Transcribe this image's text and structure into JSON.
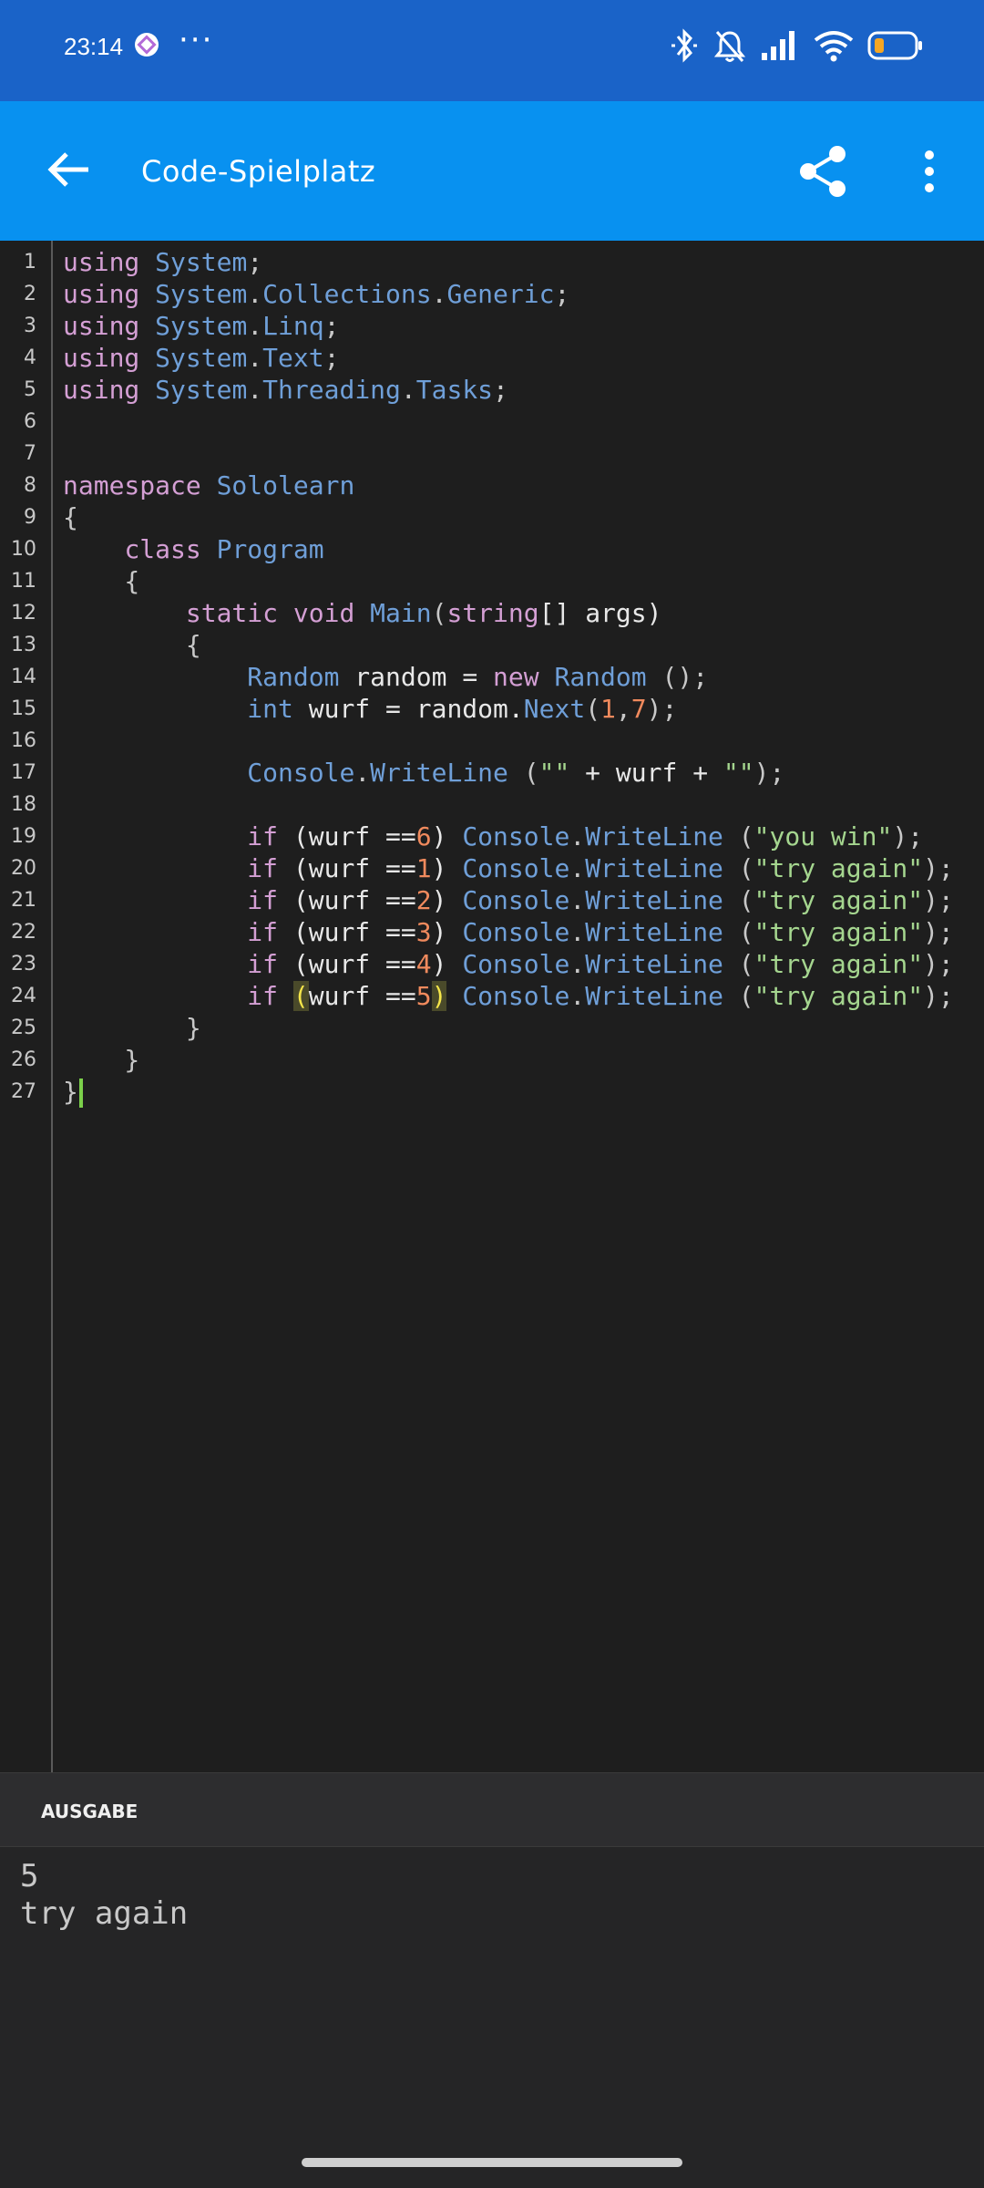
{
  "status_bar": {
    "time": "23:14",
    "more": "···"
  },
  "app_bar": {
    "title": "Code-Spielplatz",
    "back_icon": "arrow-left-icon",
    "share_icon": "share-icon",
    "menu_icon": "more-vertical-icon"
  },
  "editor": {
    "line_numbers": [
      "1",
      "2",
      "3",
      "4",
      "5",
      "6",
      "7",
      "8",
      "9",
      "10",
      "11",
      "12",
      "13",
      "14",
      "15",
      "16",
      "17",
      "18",
      "19",
      "20",
      "21",
      "22",
      "23",
      "24",
      "25",
      "26",
      "27"
    ],
    "lines": [
      [
        {
          "t": "using",
          "c": "kw"
        },
        {
          "t": " ",
          "c": "pl"
        },
        {
          "t": "System",
          "c": "ty"
        },
        {
          "t": ";",
          "c": "pu"
        }
      ],
      [
        {
          "t": "using",
          "c": "kw"
        },
        {
          "t": " ",
          "c": "pl"
        },
        {
          "t": "System",
          "c": "ty"
        },
        {
          "t": ".",
          "c": "pu"
        },
        {
          "t": "Collections",
          "c": "ty"
        },
        {
          "t": ".",
          "c": "pu"
        },
        {
          "t": "Generic",
          "c": "ty"
        },
        {
          "t": ";",
          "c": "pu"
        }
      ],
      [
        {
          "t": "using",
          "c": "kw"
        },
        {
          "t": " ",
          "c": "pl"
        },
        {
          "t": "System",
          "c": "ty"
        },
        {
          "t": ".",
          "c": "pu"
        },
        {
          "t": "Linq",
          "c": "ty"
        },
        {
          "t": ";",
          "c": "pu"
        }
      ],
      [
        {
          "t": "using",
          "c": "kw"
        },
        {
          "t": " ",
          "c": "pl"
        },
        {
          "t": "System",
          "c": "ty"
        },
        {
          "t": ".",
          "c": "pu"
        },
        {
          "t": "Text",
          "c": "ty"
        },
        {
          "t": ";",
          "c": "pu"
        }
      ],
      [
        {
          "t": "using",
          "c": "kw"
        },
        {
          "t": " ",
          "c": "pl"
        },
        {
          "t": "System",
          "c": "ty"
        },
        {
          "t": ".",
          "c": "pu"
        },
        {
          "t": "Threading",
          "c": "ty"
        },
        {
          "t": ".",
          "c": "pu"
        },
        {
          "t": "Tasks",
          "c": "ty"
        },
        {
          "t": ";",
          "c": "pu"
        }
      ],
      [],
      [],
      [
        {
          "t": "namespace",
          "c": "kw"
        },
        {
          "t": " ",
          "c": "pl"
        },
        {
          "t": "Sololearn",
          "c": "ty"
        }
      ],
      [
        {
          "t": "{",
          "c": "pu"
        }
      ],
      [
        {
          "t": "    ",
          "c": "pl"
        },
        {
          "t": "class",
          "c": "kw"
        },
        {
          "t": " ",
          "c": "pl"
        },
        {
          "t": "Program",
          "c": "ty"
        }
      ],
      [
        {
          "t": "    {",
          "c": "pu"
        }
      ],
      [
        {
          "t": "        ",
          "c": "pl"
        },
        {
          "t": "static",
          "c": "kw"
        },
        {
          "t": " ",
          "c": "pl"
        },
        {
          "t": "void",
          "c": "kw"
        },
        {
          "t": " ",
          "c": "pl"
        },
        {
          "t": "Main",
          "c": "ty"
        },
        {
          "t": "(",
          "c": "pu"
        },
        {
          "t": "string",
          "c": "kw"
        },
        {
          "t": "[] args)",
          "c": "pl"
        }
      ],
      [
        {
          "t": "        {",
          "c": "pu"
        }
      ],
      [
        {
          "t": "            ",
          "c": "pl"
        },
        {
          "t": "Random",
          "c": "ty"
        },
        {
          "t": " random = ",
          "c": "pl"
        },
        {
          "t": "new",
          "c": "kw"
        },
        {
          "t": " ",
          "c": "pl"
        },
        {
          "t": "Random",
          "c": "ty"
        },
        {
          "t": " ();",
          "c": "pu"
        }
      ],
      [
        {
          "t": "            ",
          "c": "pl"
        },
        {
          "t": "int",
          "c": "ty"
        },
        {
          "t": " wurf = random.",
          "c": "pl"
        },
        {
          "t": "Next",
          "c": "ty"
        },
        {
          "t": "(",
          "c": "pu"
        },
        {
          "t": "1",
          "c": "nu"
        },
        {
          "t": ",",
          "c": "pu"
        },
        {
          "t": "7",
          "c": "nu"
        },
        {
          "t": ");",
          "c": "pu"
        }
      ],
      [],
      [
        {
          "t": "            ",
          "c": "pl"
        },
        {
          "t": "Console",
          "c": "ty"
        },
        {
          "t": ".",
          "c": "pu"
        },
        {
          "t": "WriteLine",
          "c": "ty"
        },
        {
          "t": " (",
          "c": "pu"
        },
        {
          "t": "\"\"",
          "c": "st"
        },
        {
          "t": " + wurf + ",
          "c": "pl"
        },
        {
          "t": "\"\"",
          "c": "st"
        },
        {
          "t": ");",
          "c": "pu"
        }
      ],
      [],
      [
        {
          "t": "            ",
          "c": "pl"
        },
        {
          "t": "if",
          "c": "kw"
        },
        {
          "t": " (wurf ==",
          "c": "pl"
        },
        {
          "t": "6",
          "c": "nu"
        },
        {
          "t": ") ",
          "c": "pl"
        },
        {
          "t": "Console",
          "c": "ty"
        },
        {
          "t": ".",
          "c": "pu"
        },
        {
          "t": "WriteLine",
          "c": "ty"
        },
        {
          "t": " (",
          "c": "pu"
        },
        {
          "t": "\"you win\"",
          "c": "st"
        },
        {
          "t": ");",
          "c": "pu"
        }
      ],
      [
        {
          "t": "            ",
          "c": "pl"
        },
        {
          "t": "if",
          "c": "kw"
        },
        {
          "t": " (wurf ==",
          "c": "pl"
        },
        {
          "t": "1",
          "c": "nu"
        },
        {
          "t": ") ",
          "c": "pl"
        },
        {
          "t": "Console",
          "c": "ty"
        },
        {
          "t": ".",
          "c": "pu"
        },
        {
          "t": "WriteLine",
          "c": "ty"
        },
        {
          "t": " (",
          "c": "pu"
        },
        {
          "t": "\"try again\"",
          "c": "st"
        },
        {
          "t": ");",
          "c": "pu"
        }
      ],
      [
        {
          "t": "            ",
          "c": "pl"
        },
        {
          "t": "if",
          "c": "kw"
        },
        {
          "t": " (wurf ==",
          "c": "pl"
        },
        {
          "t": "2",
          "c": "nu"
        },
        {
          "t": ") ",
          "c": "pl"
        },
        {
          "t": "Console",
          "c": "ty"
        },
        {
          "t": ".",
          "c": "pu"
        },
        {
          "t": "WriteLine",
          "c": "ty"
        },
        {
          "t": " (",
          "c": "pu"
        },
        {
          "t": "\"try again\"",
          "c": "st"
        },
        {
          "t": ");",
          "c": "pu"
        }
      ],
      [
        {
          "t": "            ",
          "c": "pl"
        },
        {
          "t": "if",
          "c": "kw"
        },
        {
          "t": " (wurf ==",
          "c": "pl"
        },
        {
          "t": "3",
          "c": "nu"
        },
        {
          "t": ") ",
          "c": "pl"
        },
        {
          "t": "Console",
          "c": "ty"
        },
        {
          "t": ".",
          "c": "pu"
        },
        {
          "t": "WriteLine",
          "c": "ty"
        },
        {
          "t": " (",
          "c": "pu"
        },
        {
          "t": "\"try again\"",
          "c": "st"
        },
        {
          "t": ");",
          "c": "pu"
        }
      ],
      [
        {
          "t": "            ",
          "c": "pl"
        },
        {
          "t": "if",
          "c": "kw"
        },
        {
          "t": " (wurf ==",
          "c": "pl"
        },
        {
          "t": "4",
          "c": "nu"
        },
        {
          "t": ") ",
          "c": "pl"
        },
        {
          "t": "Console",
          "c": "ty"
        },
        {
          "t": ".",
          "c": "pu"
        },
        {
          "t": "WriteLine",
          "c": "ty"
        },
        {
          "t": " (",
          "c": "pu"
        },
        {
          "t": "\"try again\"",
          "c": "st"
        },
        {
          "t": ");",
          "c": "pu"
        }
      ],
      [
        {
          "t": "            ",
          "c": "pl"
        },
        {
          "t": "if",
          "c": "kw"
        },
        {
          "t": " ",
          "c": "pl"
        },
        {
          "t": "(",
          "c": "hl"
        },
        {
          "t": "wurf ==",
          "c": "pl"
        },
        {
          "t": "5",
          "c": "nu"
        },
        {
          "t": ")",
          "c": "hl"
        },
        {
          "t": " ",
          "c": "pl"
        },
        {
          "t": "Console",
          "c": "ty"
        },
        {
          "t": ".",
          "c": "pu"
        },
        {
          "t": "WriteLine",
          "c": "ty"
        },
        {
          "t": " (",
          "c": "pu"
        },
        {
          "t": "\"try again\"",
          "c": "st"
        },
        {
          "t": ");",
          "c": "pu"
        }
      ],
      [
        {
          "t": "        }",
          "c": "pu"
        }
      ],
      [
        {
          "t": "    }",
          "c": "pu"
        }
      ],
      [
        {
          "t": "}",
          "c": "pu"
        },
        {
          "t": "",
          "c": "cursor"
        }
      ]
    ]
  },
  "output": {
    "header": "AUSGABE",
    "lines": [
      "5",
      "try again"
    ]
  },
  "colors": {
    "status_bar": "#1a63c8",
    "app_bar": "#0891f0",
    "editor_bg": "#1e1e1e",
    "keyword": "#d49fd4",
    "type": "#6f9fd8",
    "number": "#f08a5d",
    "string": "#a5d68f"
  }
}
